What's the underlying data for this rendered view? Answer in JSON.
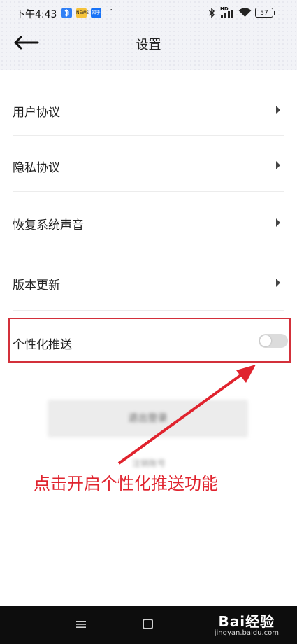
{
  "status_bar": {
    "time": "下午4:43",
    "app_icons": [
      {
        "icon": "bluetooth-app-icon",
        "color": "#2f7ff5",
        "text": ""
      },
      {
        "icon": "news-app-icon",
        "color": "#f5c33b",
        "text": "NEWS"
      },
      {
        "icon": "zhihu-app-icon",
        "color": "#1772f6",
        "text": "知乎"
      }
    ],
    "network_label": "HD",
    "battery": "57"
  },
  "header": {
    "title": "设置"
  },
  "settings": {
    "items": [
      {
        "label": "用户协议"
      },
      {
        "label": "隐私协议"
      },
      {
        "label": "恢复系统声音"
      },
      {
        "label": "版本更新"
      }
    ],
    "personalized_push": {
      "label": "个性化推送",
      "enabled": false
    }
  },
  "account": {
    "logout_label": "退出登录",
    "delete_label": "注销账号"
  },
  "annotation": {
    "text": "点击开启个性化推送功能",
    "color": "#e0232e"
  },
  "watermark": {
    "logo": "Bai经验",
    "site": "jingyan.baidu.com"
  }
}
